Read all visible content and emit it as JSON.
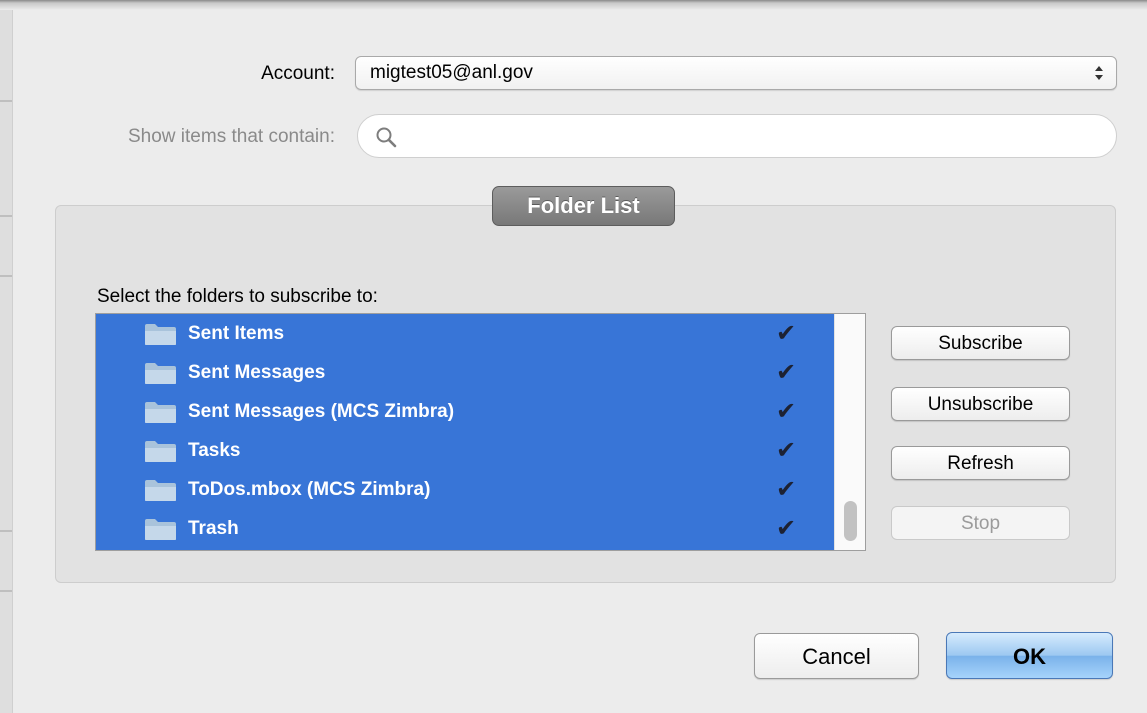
{
  "form": {
    "account_label": "Account:",
    "account_value": "migtest05@anl.gov",
    "filter_label": "Show items that contain:",
    "filter_value": "",
    "filter_placeholder": ""
  },
  "folder_list": {
    "title": "Folder List",
    "prompt": "Select the folders to subscribe to:",
    "items": [
      {
        "name": "Sent Items",
        "check": "✔"
      },
      {
        "name": "Sent Messages",
        "check": "✔"
      },
      {
        "name": "Sent Messages (MCS Zimbra)",
        "check": "✔"
      },
      {
        "name": "Tasks",
        "check": "✔"
      },
      {
        "name": "ToDos.mbox (MCS Zimbra)",
        "check": "✔"
      },
      {
        "name": "Trash",
        "check": "✔"
      }
    ]
  },
  "actions": {
    "subscribe": "Subscribe",
    "unsubscribe": "Unsubscribe",
    "refresh": "Refresh",
    "stop": "Stop"
  },
  "dialog_buttons": {
    "cancel": "Cancel",
    "ok": "OK"
  },
  "colors": {
    "selection": "#3875d7",
    "default_button": "#8fc1f0",
    "group_title": "#8a8a8a"
  },
  "icons": {
    "popup": "up-down-arrows-icon",
    "search": "magnifier-icon",
    "folder": "folder-icon",
    "check": "checkmark-icon"
  }
}
